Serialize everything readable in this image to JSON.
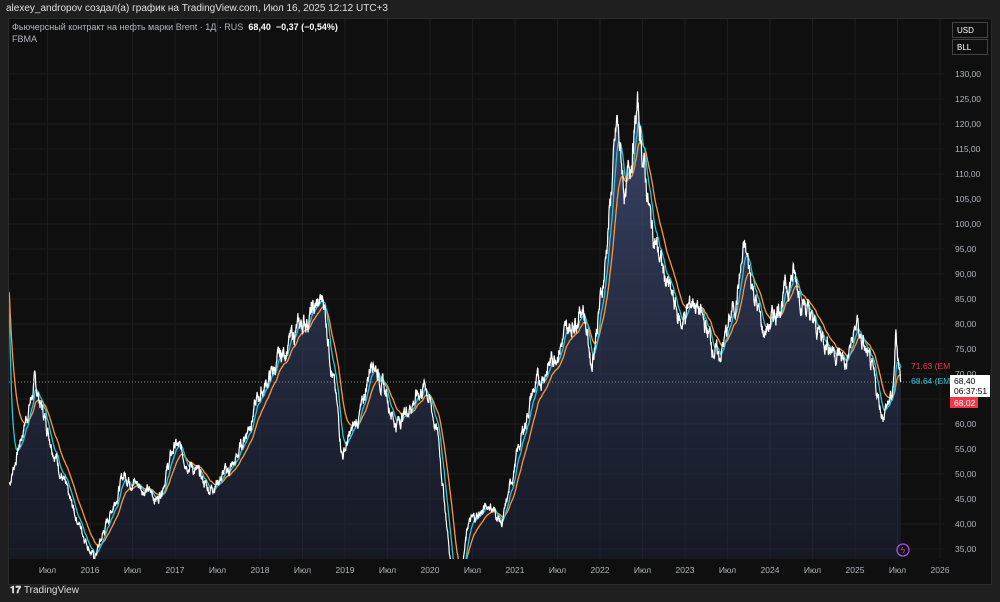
{
  "header": {
    "author_line": "alexey_andropov создал(а) график на TradingView.com, Июл 16, 2025 12:12 UTC+3"
  },
  "legend": {
    "symbol": "Фьючерсный контракт на нефть марки Brent · 1Д · RUS",
    "last": "68,40",
    "change": "−0,37 (−0,54%)",
    "indicator": "FBMA"
  },
  "buttons": {
    "currency": "USD",
    "unit": "BLL"
  },
  "footer": {
    "brand": "TradingView"
  },
  "colors": {
    "price": "#ffffff",
    "ema_fast": "#26c6da",
    "ema_slow": "#ff9832",
    "down": "#f23645"
  },
  "chart_data": {
    "type": "line",
    "title": "Фьючерсный контракт на нефть марки Brent",
    "ylim": [
      33,
      133
    ],
    "y_ticks": [
      "35,00",
      "40,00",
      "45,00",
      "50,00",
      "55,00",
      "60,00",
      "65,00",
      "70,00",
      "75,00",
      "80,00",
      "85,00",
      "90,00",
      "95,00",
      "100,00",
      "105,00",
      "110,00",
      "115,00",
      "120,00",
      "125,00",
      "130,00"
    ],
    "x_ticks": [
      {
        "t": 2015.5,
        "label": "Июл"
      },
      {
        "t": 2016,
        "label": "2016"
      },
      {
        "t": 2016.5,
        "label": "Июл"
      },
      {
        "t": 2017,
        "label": "2017"
      },
      {
        "t": 2017.5,
        "label": "Июл"
      },
      {
        "t": 2018,
        "label": "2018"
      },
      {
        "t": 2018.5,
        "label": "Июл"
      },
      {
        "t": 2019,
        "label": "2019"
      },
      {
        "t": 2019.5,
        "label": "Июл"
      },
      {
        "t": 2020,
        "label": "2020"
      },
      {
        "t": 2020.5,
        "label": "Июл"
      },
      {
        "t": 2021,
        "label": "2021"
      },
      {
        "t": 2021.5,
        "label": "Июл"
      },
      {
        "t": 2022,
        "label": "2022"
      },
      {
        "t": 2022.5,
        "label": "Июл"
      },
      {
        "t": 2023,
        "label": "2023"
      },
      {
        "t": 2023.5,
        "label": "Июл"
      },
      {
        "t": 2024,
        "label": "2024"
      },
      {
        "t": 2024.5,
        "label": "Июл"
      },
      {
        "t": 2025,
        "label": "2025"
      },
      {
        "t": 2025.5,
        "label": "Июл"
      },
      {
        "t": 2026,
        "label": "2026"
      }
    ],
    "price_keypoints": [
      [
        2015.05,
        48
      ],
      [
        2015.35,
        68
      ],
      [
        2015.75,
        45
      ],
      [
        2016.05,
        33
      ],
      [
        2016.4,
        50
      ],
      [
        2016.8,
        45
      ],
      [
        2017.0,
        56
      ],
      [
        2017.4,
        47
      ],
      [
        2017.7,
        52
      ],
      [
        2018.0,
        66
      ],
      [
        2018.4,
        78
      ],
      [
        2018.75,
        85
      ],
      [
        2018.97,
        54
      ],
      [
        2019.2,
        63
      ],
      [
        2019.32,
        74
      ],
      [
        2019.6,
        60
      ],
      [
        2019.95,
        68
      ],
      [
        2020.1,
        57
      ],
      [
        2020.3,
        22
      ],
      [
        2020.45,
        40
      ],
      [
        2020.7,
        44
      ],
      [
        2020.85,
        40
      ],
      [
        2021.0,
        52
      ],
      [
        2021.2,
        66
      ],
      [
        2021.5,
        75
      ],
      [
        2021.8,
        84
      ],
      [
        2021.9,
        72
      ],
      [
        2022.05,
        90
      ],
      [
        2022.2,
        120
      ],
      [
        2022.3,
        105
      ],
      [
        2022.44,
        123
      ],
      [
        2022.6,
        100
      ],
      [
        2022.75,
        90
      ],
      [
        2022.95,
        80
      ],
      [
        2023.1,
        85
      ],
      [
        2023.4,
        73
      ],
      [
        2023.6,
        85
      ],
      [
        2023.7,
        95
      ],
      [
        2023.92,
        78
      ],
      [
        2024.0,
        80
      ],
      [
        2024.27,
        90
      ],
      [
        2024.5,
        80
      ],
      [
        2024.7,
        76
      ],
      [
        2024.9,
        72
      ],
      [
        2025.02,
        80
      ],
      [
        2025.2,
        70
      ],
      [
        2025.32,
        62
      ],
      [
        2025.45,
        66
      ],
      [
        2025.48,
        78
      ],
      [
        2025.54,
        68.4
      ]
    ],
    "ema_fast": {
      "label": "68.64 (EM",
      "value": 68.64
    },
    "ema_slow": {
      "label": "71.63 (EM",
      "value": 71.63
    },
    "last_price": {
      "value": 68.4,
      "label": "68,40",
      "countdown": "06:37:51"
    },
    "bid": {
      "value": 68.02,
      "label": "68,02"
    }
  }
}
